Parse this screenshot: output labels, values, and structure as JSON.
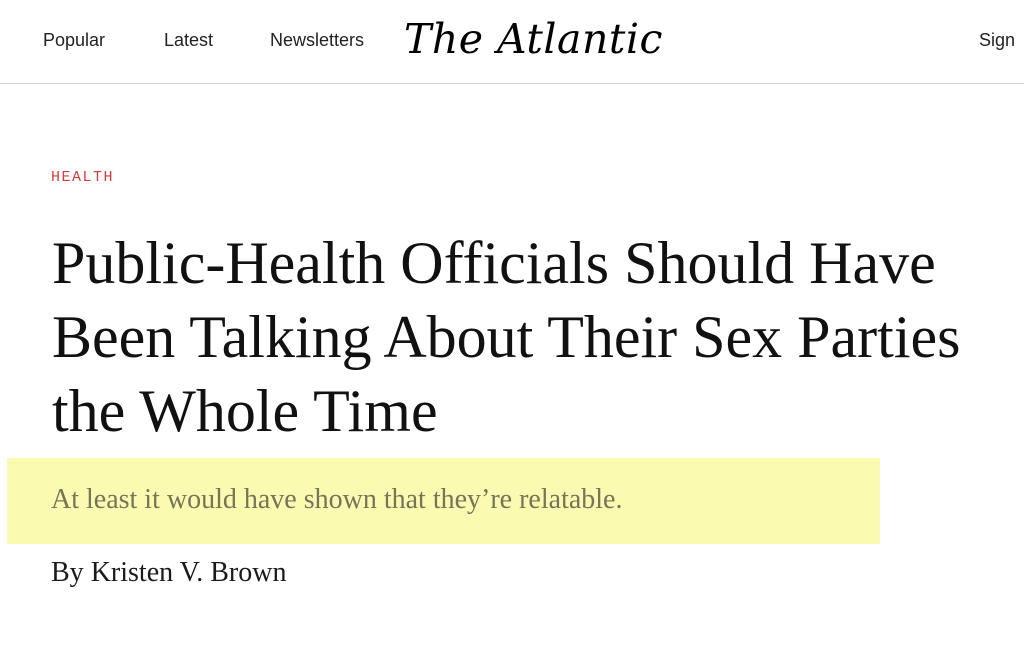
{
  "nav": {
    "popular": "Popular",
    "latest": "Latest",
    "newsletters": "Newsletters",
    "logo": "The Atlantic",
    "sign_in": "Sign"
  },
  "article": {
    "section": "HEALTH",
    "headline": "Public-Health Officials Should Have Been Talking About Their Sex Parties the Whole Time",
    "dek": "At least it would have shown that they’re relatable.",
    "byline_prefix": "By ",
    "author": "Kristen V. Brown"
  },
  "colors": {
    "section_label": "#d83a3a",
    "highlight": "#fafab1",
    "dek_text": "#75755a"
  }
}
